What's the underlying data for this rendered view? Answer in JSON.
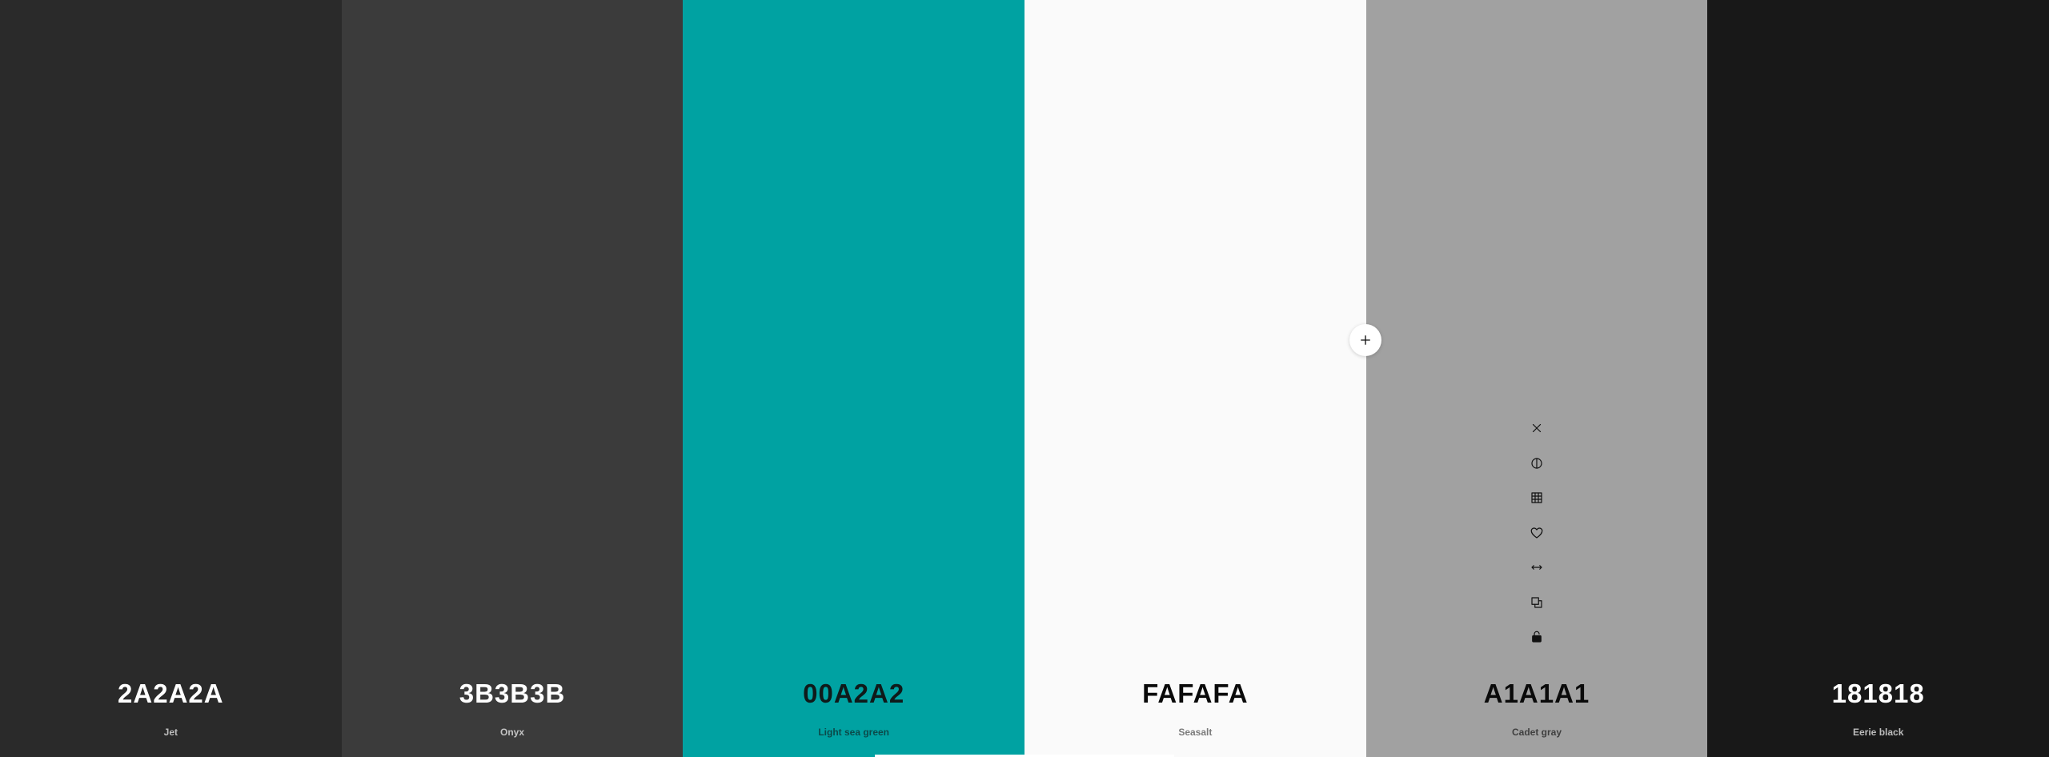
{
  "palette": {
    "swatches": [
      {
        "hex": "2A2A2A",
        "name": "Jet",
        "color": "#2A2A2A",
        "text_color": "#FFFFFF",
        "name_color": "#BDBDBD"
      },
      {
        "hex": "3B3B3B",
        "name": "Onyx",
        "color": "#3B3B3B",
        "text_color": "#FFFFFF",
        "name_color": "#C4C4C4"
      },
      {
        "hex": "00A2A2",
        "name": "Light sea green",
        "color": "#00A2A2",
        "text_color": "#0F1A1A",
        "name_color": "#0B4A4A"
      },
      {
        "hex": "FAFAFA",
        "name": "Seasalt",
        "color": "#FAFAFA",
        "text_color": "#0A0A0A",
        "name_color": "#7A7A7A"
      },
      {
        "hex": "A1A1A1",
        "name": "Cadet gray",
        "color": "#A1A1A1",
        "text_color": "#0A0A0A",
        "name_color": "#3F3F3F"
      },
      {
        "hex": "181818",
        "name": "Eerie black",
        "color": "#181818",
        "text_color": "#FFFFFF",
        "name_color": "#BDBDBD"
      }
    ]
  },
  "tools": [
    "close-icon",
    "contrast-icon",
    "grid-icon",
    "heart-icon",
    "drag-arrows-icon",
    "copy-icon",
    "lock-icon"
  ],
  "add_button": {
    "icon": "plus-icon"
  }
}
